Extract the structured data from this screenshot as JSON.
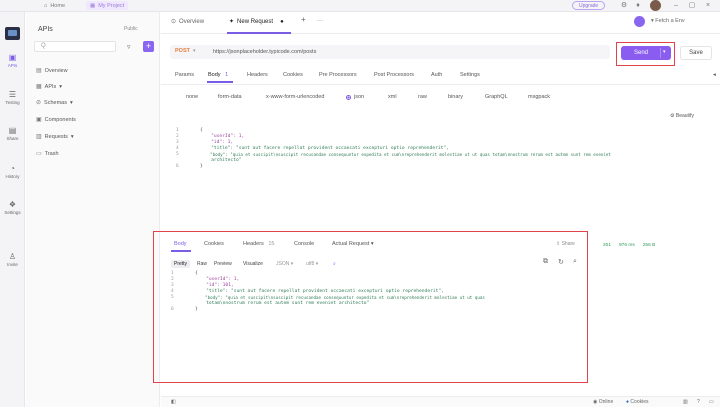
{
  "topbar": {
    "home_tab": "Home",
    "project_tab": "My Project",
    "upgrade": "Upgrade"
  },
  "rail": {
    "items": [
      {
        "label": "APIs",
        "icon": "apis-icon"
      },
      {
        "label": "Testing",
        "icon": "testing-icon"
      },
      {
        "label": "Share",
        "icon": "share-icon"
      },
      {
        "label": "History",
        "icon": "history-icon"
      },
      {
        "label": "Settings",
        "icon": "settings-icon"
      },
      {
        "label": "Invite",
        "icon": "invite-icon"
      }
    ]
  },
  "sidebar": {
    "title": "APIs",
    "team": "Public",
    "search_placeholder": "Q",
    "items": [
      {
        "label": "Overview",
        "icon": "overview-icon"
      },
      {
        "label": "APIs",
        "icon": "apis-icon"
      },
      {
        "label": "Schemas",
        "icon": "schemas-icon"
      },
      {
        "label": "Components",
        "icon": "components-icon"
      },
      {
        "label": "Requests",
        "icon": "requests-icon"
      },
      {
        "label": "Trash",
        "icon": "trash-icon"
      }
    ]
  },
  "tabs": {
    "overview": "Overview",
    "new_request": "New Request",
    "env": "Fetch a Env"
  },
  "request": {
    "method": "POST",
    "url": "https://jsonplaceholder.typicode.com/posts",
    "send_label": "Send",
    "save_label": "Save",
    "subtabs": [
      {
        "label": "Params"
      },
      {
        "label": "Body"
      },
      {
        "label": "Headers"
      },
      {
        "label": "Cookies"
      },
      {
        "label": "Pre Processors"
      },
      {
        "label": "Post Processors"
      },
      {
        "label": "Auth"
      },
      {
        "label": "Settings"
      }
    ],
    "body_count": "1",
    "body_types": [
      "none",
      "form-data",
      "x-www-form-urlencoded",
      "json",
      "xml",
      "raw",
      "binary",
      "GraphQL",
      "msgpack"
    ],
    "selected_body_type": "json",
    "beautify": "Beautify",
    "code_lines": [
      {
        "n": "1",
        "t": "{"
      },
      {
        "n": "2",
        "t": "    \"userId\": 1,"
      },
      {
        "n": "3",
        "t": "    \"id\": 1,"
      },
      {
        "n": "4",
        "t": "    \"title\": \"sunt aut facere repellat provident occaecati excepturi optio reprehenderit\","
      },
      {
        "n": "5",
        "t": "    \"body\": \"quia et suscipit\\nsuscipit recusandae consequuntur expedita et cum\\nreprehenderit molestiae ut ut quas totam\\nnostrum rerum est autem sunt rem eveniet"
      },
      {
        "n": "",
        "t": "    architecto\""
      },
      {
        "n": "6",
        "t": "}"
      }
    ]
  },
  "status": {
    "code": "201",
    "time": "976 ms",
    "size": "256 B"
  },
  "response": {
    "tabs": [
      {
        "label": "Body"
      },
      {
        "label": "Cookies"
      },
      {
        "label": "Headers"
      },
      {
        "label": "Console"
      },
      {
        "label": "Actual Request"
      }
    ],
    "headers_count": "15",
    "share": "Share",
    "formats": [
      "Pretty",
      "Raw",
      "Preview",
      "Visualize"
    ],
    "format_type": "JSON",
    "encoding": "utf8",
    "code_lines": [
      {
        "n": "1",
        "t": "{"
      },
      {
        "n": "2",
        "t": "    \"userId\": 1,"
      },
      {
        "n": "3",
        "t": "    \"id\": 101,"
      },
      {
        "n": "4",
        "t": "    \"title\": \"sunt aut facere repellat provident occaecati excepturi optio reprehenderit\","
      },
      {
        "n": "5",
        "t": "    \"body\": \"quia et suscipit\\nsuscipit recusandae consequuntur expedita et cum\\nreprehenderit molestiae ut ut quas"
      },
      {
        "n": "",
        "t": "    totam\\nnostrum rerum est autem sunt rem eveniet architecto\""
      },
      {
        "n": "6",
        "t": "}"
      }
    ]
  },
  "bottombar": {
    "online": "Online",
    "cookies": "Cookies"
  },
  "colors": {
    "accent": "#8a5cf0",
    "method": "#e77c3a",
    "highlight": "#e0434a",
    "success": "#2e9a56"
  }
}
